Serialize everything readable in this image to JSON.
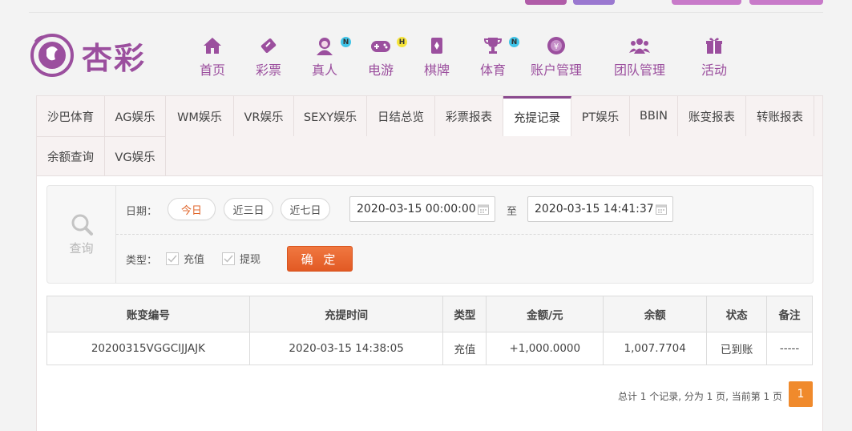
{
  "brand": {
    "name": "杏彩",
    "color": "#9b4f9e"
  },
  "nav": [
    {
      "label": "首页",
      "icon": "home-icon",
      "badge": ""
    },
    {
      "label": "彩票",
      "icon": "ticket-icon",
      "badge": ""
    },
    {
      "label": "真人",
      "icon": "dealer-icon",
      "badge": "N"
    },
    {
      "label": "电游",
      "icon": "gamepad-icon",
      "badge": "H"
    },
    {
      "label": "棋牌",
      "icon": "cards-icon",
      "badge": ""
    },
    {
      "label": "体育",
      "icon": "trophy-icon",
      "badge": "N"
    },
    {
      "label": "账户管理",
      "icon": "coin-icon",
      "badge": ""
    },
    {
      "label": "团队管理",
      "icon": "team-icon",
      "badge": ""
    },
    {
      "label": "活动",
      "icon": "gift-icon",
      "badge": ""
    }
  ],
  "tabs": [
    "沙巴体育",
    "AG娱乐",
    "WM娱乐",
    "VR娱乐",
    "SEXY娱乐",
    "日结总览",
    "彩票报表",
    "充提记录",
    "PT娱乐",
    "BBIN",
    "账变报表",
    "转账报表",
    "余额查询",
    "VG娱乐"
  ],
  "active_tab": "充提记录",
  "filter": {
    "side_label": "查询",
    "date_label": "日期：",
    "quick": [
      "今日",
      "近三日",
      "近七日"
    ],
    "start": "2020-03-15 00:00:00",
    "to": "至",
    "end": "2020-03-15 14:41:37",
    "type_label": "类型：",
    "types": [
      "充值",
      "提现"
    ],
    "confirm": "确 定"
  },
  "table": {
    "headers": [
      "账变编号",
      "充提时间",
      "类型",
      "金额/元",
      "余额",
      "状态",
      "备注"
    ],
    "rows": [
      [
        "20200315VGGCIJJAJK",
        "2020-03-15 14:38:05",
        "充值",
        "+1,000.0000",
        "1,007.7704",
        "已到账",
        "-----"
      ]
    ]
  },
  "pager": {
    "summary": "总计 1 个记录, 分为 1 页, 当前第 1 页",
    "page": "1"
  }
}
